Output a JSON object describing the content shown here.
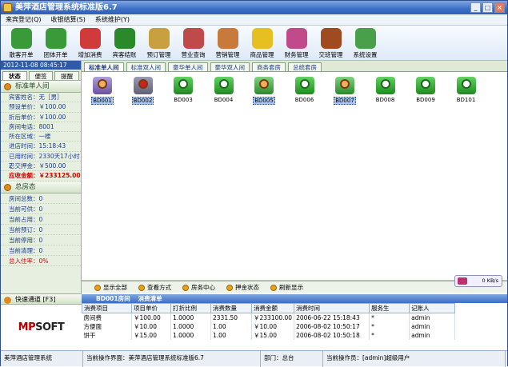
{
  "window": {
    "title": "美萍酒店管理系统标准版6.7"
  },
  "menu": [
    "来宾登记(Q)",
    "收银结算(S)",
    "系统维护(Y)"
  ],
  "toolbar": [
    {
      "label": "散客开单",
      "icon": "guest-icon",
      "color": "#3a9a3a"
    },
    {
      "label": "团体开单",
      "icon": "group-icon",
      "color": "#3a9a3a"
    },
    {
      "label": "增加消费",
      "icon": "add-icon",
      "color": "#d03a3a"
    },
    {
      "label": "宾客结账",
      "icon": "checkout-icon",
      "color": "#2a8a2a"
    },
    {
      "label": "预订管理",
      "icon": "clock-icon",
      "color": "#c8a040"
    },
    {
      "label": "营业查询",
      "icon": "tools-icon",
      "color": "#c04a4a"
    },
    {
      "label": "营销管理",
      "icon": "people-icon",
      "color": "#c87a3a"
    },
    {
      "label": "商品管理",
      "icon": "star-icon",
      "color": "#e6c020"
    },
    {
      "label": "财务管理",
      "icon": "finance-icon",
      "color": "#c04a8a"
    },
    {
      "label": "交班管理",
      "icon": "exit-icon",
      "color": "#a04a20"
    },
    {
      "label": "系统设置",
      "icon": "gear-icon",
      "color": "#4aa04a"
    }
  ],
  "left": {
    "clock": "2012-11-08 08:45:17",
    "tabs": [
      "状态",
      "便签",
      "提醒"
    ],
    "room_section": "标准单人间",
    "info": [
      {
        "text": "宾客姓名：无［男］",
        "red": false
      },
      {
        "text": "预设单价：￥100.00",
        "red": false
      },
      {
        "text": "折后单价：￥100.00",
        "red": false
      },
      {
        "text": "房间电话：8001",
        "red": false
      },
      {
        "text": "所在区域：一楼",
        "red": false
      },
      {
        "text": "进店时间：15:18:43",
        "red": false
      },
      {
        "text": "已用时间：2330天17小时2",
        "red": false
      },
      {
        "text": "已交押金：￥500.00",
        "red": false
      },
      {
        "text": "应收金额：￥233125.00",
        "red": true
      }
    ],
    "stats_section": "总房态",
    "stats": [
      {
        "text": "房间总数：0",
        "red": false
      },
      {
        "text": "当前可供：0",
        "red": false
      },
      {
        "text": "当前占用：0",
        "red": false
      },
      {
        "text": "当前预订：0",
        "red": false
      },
      {
        "text": "当前停用：0",
        "red": false
      },
      {
        "text": "当前清理：0",
        "red": false
      },
      {
        "text": "总入住率：0%",
        "red": true
      }
    ],
    "quick": "快速通道 [F3]",
    "logo_a": "MP",
    "logo_b": "SOFT"
  },
  "room_tabs": [
    "标准单人间",
    "标准双人间",
    "豪华单人间",
    "豪华双人间",
    "商务套房",
    "总统套房"
  ],
  "rooms": [
    {
      "id": "BD001",
      "state": "occupied",
      "selected": true
    },
    {
      "id": "BD002",
      "state": "stopped",
      "selected": true
    },
    {
      "id": "BD003",
      "state": "free",
      "selected": false
    },
    {
      "id": "BD004",
      "state": "free",
      "selected": false
    },
    {
      "id": "BD005",
      "state": "occupied2",
      "selected": true
    },
    {
      "id": "BD006",
      "state": "free",
      "selected": false
    },
    {
      "id": "BD007",
      "state": "occupied2",
      "selected": true
    },
    {
      "id": "BD008",
      "state": "free",
      "selected": false
    },
    {
      "id": "BD009",
      "state": "free",
      "selected": false
    },
    {
      "id": "BD101",
      "state": "free",
      "selected": false
    }
  ],
  "bottom_actions": [
    "显示全部",
    "查看方式",
    "房务中心",
    "押金状态",
    "刷新显示"
  ],
  "detail": {
    "room_label": "BD001房间",
    "detail_label": "消费清单",
    "columns": [
      "消费项目",
      "项目单价",
      "打折比例",
      "消费数量",
      "消费金额",
      "消费时间",
      "服务生",
      "记账人"
    ],
    "rows": [
      [
        "房间费",
        "￥100.00",
        "1.0000",
        "2331.50",
        "￥233100.00",
        "2006-06-22 15:18:43",
        "*",
        "admin"
      ],
      [
        "方便面",
        "￥10.00",
        "1.0000",
        "1.00",
        "￥10.00",
        "2006-08-02 10:50:17",
        "*",
        "admin"
      ],
      [
        "饼干",
        "￥15.00",
        "1.0000",
        "1.00",
        "￥15.00",
        "2006-08-02 10:50:18",
        "*",
        "admin"
      ]
    ],
    "net": "0 KB/s"
  },
  "statusbar": [
    "美萍酒店管理系统",
    "当前操作界面：美萍酒店管理系统标准版6.7",
    "部门：总台",
    "当前操作员：[admin]超级用户"
  ]
}
